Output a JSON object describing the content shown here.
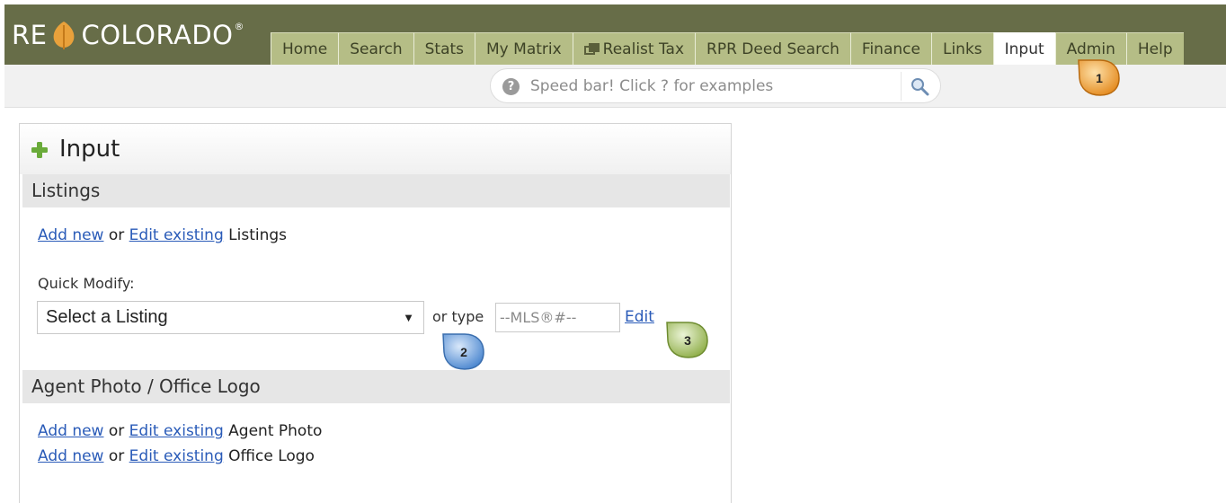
{
  "logo": {
    "left": "RE",
    "right": "COLORADO",
    "mark": "®"
  },
  "tabs": [
    {
      "label": "Home",
      "active": false
    },
    {
      "label": "Search",
      "active": false
    },
    {
      "label": "Stats",
      "active": false
    },
    {
      "label": "My Matrix",
      "active": false
    },
    {
      "label": "Realist Tax",
      "active": false,
      "icon": "window-icon"
    },
    {
      "label": "RPR Deed Search",
      "active": false
    },
    {
      "label": "Finance",
      "active": false
    },
    {
      "label": "Links",
      "active": false
    },
    {
      "label": "Input",
      "active": true
    },
    {
      "label": "Admin",
      "active": false
    },
    {
      "label": "Help",
      "active": false
    }
  ],
  "speedbar": {
    "help_glyph": "?",
    "placeholder": "Speed bar! Click ? for examples"
  },
  "panel": {
    "title": "Input",
    "listings": {
      "heading": "Listings",
      "add_new": "Add new",
      "or": "or",
      "edit_existing": "Edit existing",
      "suffix": "Listings",
      "quick_modify_label": "Quick Modify:",
      "select_value": "Select a Listing",
      "select_arrow": "▼",
      "or_type": "or type",
      "mls_placeholder": "--MLS®#--",
      "edit": "Edit"
    },
    "photo": {
      "heading": "Agent Photo / Office Logo",
      "add_new": "Add new",
      "or": "or",
      "edit_existing": "Edit existing",
      "agent_suffix": "Agent Photo",
      "office_suffix": "Office Logo"
    }
  },
  "markers": [
    {
      "number": "1",
      "color": "#f0a23c"
    },
    {
      "number": "2",
      "color": "#5b9bd5"
    },
    {
      "number": "3",
      "color": "#9dbb5a"
    }
  ],
  "colors": {
    "header_bg": "#676d48",
    "tab_bg": "#b5bd86",
    "link": "#2a5bb8"
  }
}
